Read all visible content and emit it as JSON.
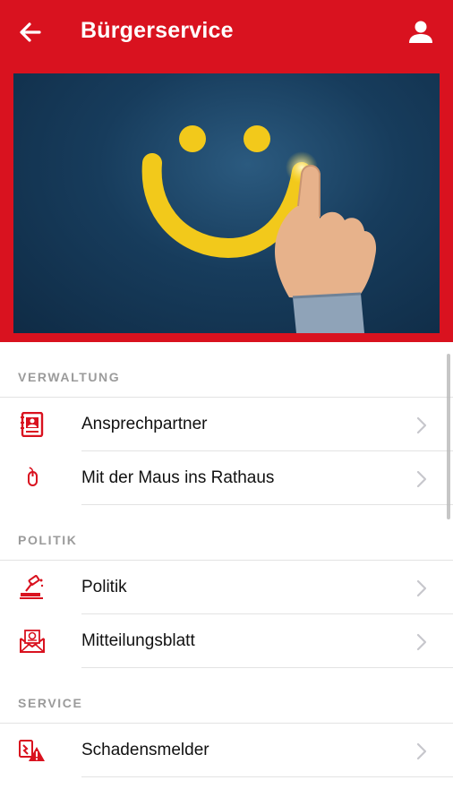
{
  "header": {
    "title": "Bürgerservice",
    "back_icon": "arrow-left-icon",
    "profile_icon": "user-icon",
    "bg_color": "#d9121f"
  },
  "hero": {
    "description_icon": "smiley-touch-image"
  },
  "sections": [
    {
      "title": "VERWALTUNG",
      "items": [
        {
          "label": "Ansprechpartner",
          "icon": "contact-book-icon"
        },
        {
          "label": "Mit der Maus ins Rathaus",
          "icon": "mouse-icon"
        }
      ]
    },
    {
      "title": "POLITIK",
      "items": [
        {
          "label": "Politik",
          "icon": "gavel-icon"
        },
        {
          "label": "Mitteilungsblatt",
          "icon": "newsletter-icon"
        }
      ]
    },
    {
      "title": "SERVICE",
      "items": [
        {
          "label": "Schadensmelder",
          "icon": "damage-report-icon"
        }
      ]
    }
  ],
  "colors": {
    "accent": "#d9121f",
    "section_title": "#9b9b9b",
    "divider": "#e3e3e3"
  }
}
